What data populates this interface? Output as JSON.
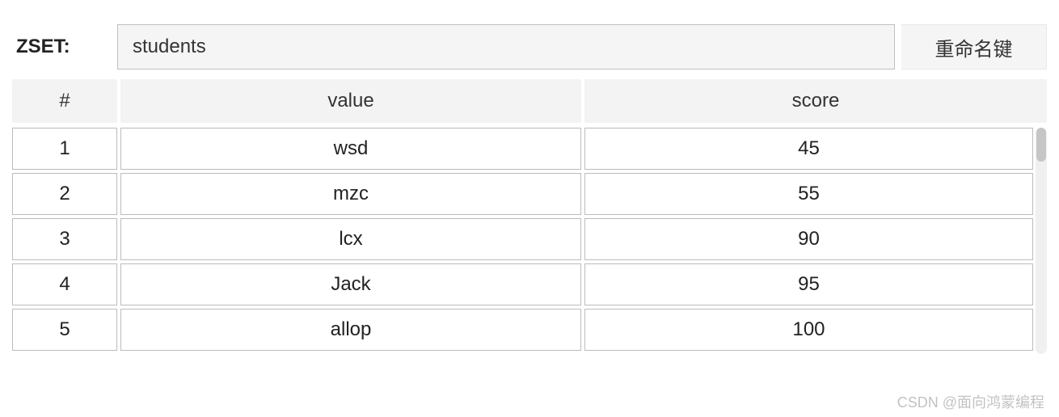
{
  "header": {
    "type_label": "ZSET:",
    "key_value": "students",
    "rename_label": "重命名键"
  },
  "table": {
    "columns": {
      "index": "#",
      "value": "value",
      "score": "score"
    },
    "rows": [
      {
        "index": "1",
        "value": "wsd",
        "score": "45"
      },
      {
        "index": "2",
        "value": "mzc",
        "score": "55"
      },
      {
        "index": "3",
        "value": "lcx",
        "score": "90"
      },
      {
        "index": "4",
        "value": "Jack",
        "score": "95"
      },
      {
        "index": "5",
        "value": "allop",
        "score": "100"
      }
    ]
  },
  "watermark": "CSDN @面向鸿蒙编程",
  "chart_data": {
    "type": "table",
    "title": "ZSET students",
    "columns": [
      "#",
      "value",
      "score"
    ],
    "rows": [
      [
        1,
        "wsd",
        45
      ],
      [
        2,
        "mzc",
        55
      ],
      [
        3,
        "lcx",
        90
      ],
      [
        4,
        "Jack",
        95
      ],
      [
        5,
        "allop",
        100
      ]
    ]
  }
}
